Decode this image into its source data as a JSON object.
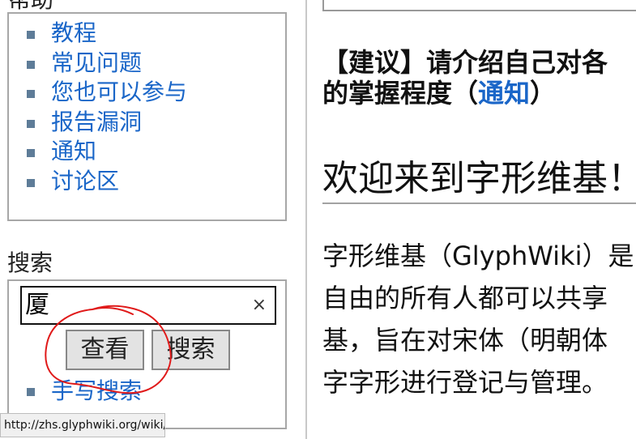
{
  "sidebar": {
    "help_heading": "帮助",
    "help_items": [
      {
        "label": "教程"
      },
      {
        "label": "常见问题"
      },
      {
        "label": "您也可以参与"
      },
      {
        "label": "报告漏洞"
      },
      {
        "label": "通知"
      },
      {
        "label": "讨论区"
      }
    ],
    "search_heading": "搜索",
    "search_value": "厦",
    "clear_icon": "×",
    "view_button": "查看",
    "search_button": "搜索",
    "handwrite_link": "手写搜索"
  },
  "status_bar": {
    "url": "http://zhs.glyphwiki.org/wiki/C"
  },
  "main": {
    "notice_line1": "【建议】请介绍自己对各",
    "notice_line2_prefix": "的掌握程度（",
    "notice_link": "通知",
    "notice_line2_suffix": "）",
    "heading": "欢迎来到字形维基！",
    "intro_lines": [
      "字形维基（GlyphWiki）是",
      "自由的所有人都可以共享",
      "基，旨在对宋体（明朝体",
      "字字形进行登记与管理。"
    ]
  },
  "colors": {
    "link": "#1a66c8",
    "bullet": "#5e7c98",
    "annotation": "#e01a1a"
  }
}
